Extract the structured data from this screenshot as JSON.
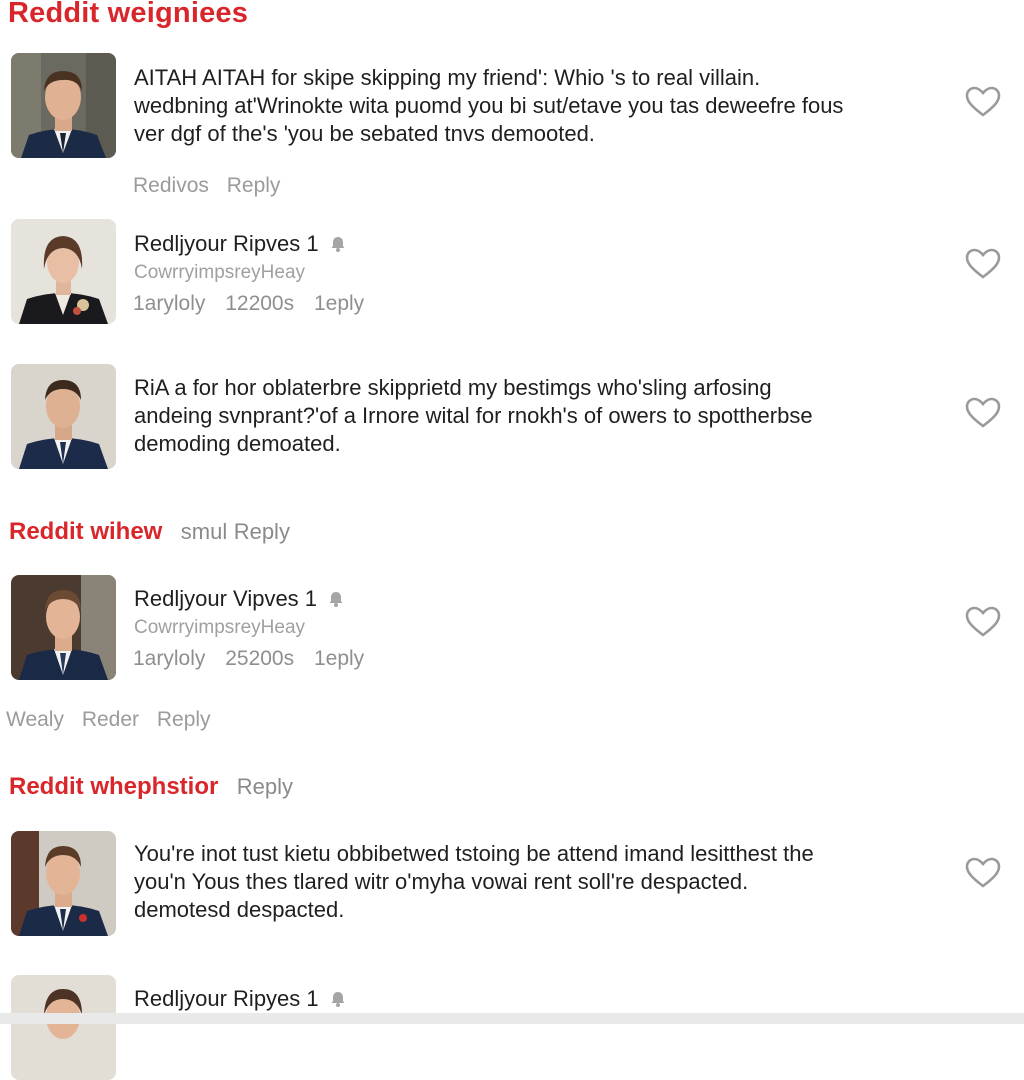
{
  "header": {
    "title": "Reddit weigniees"
  },
  "posts": [
    {
      "lines": [
        "AITAH AITAH for skipe skipping my friend': Whio 's to real villain.",
        "wedbning at'Wrinokte wita puomd you bi sut/etave you tas deweefre fous",
        "ver dgf of the's 'you be sebated tnvs demooted."
      ],
      "actions": [
        "Redivos",
        "Reply"
      ]
    },
    {
      "name": "Redljyour Ripves 1",
      "subtitle": "CowrryimpsreyHeay",
      "stats": [
        "1aryloly",
        "12200s",
        "1eply"
      ]
    },
    {
      "lines": [
        "RiA a for hor oblaterbre skipprietd my bestimgs who'sling arfosing",
        "andeing svnprant?'of a Irnore wital for rnokh's of owers to spottherbse",
        "demoding demoated."
      ]
    }
  ],
  "section1": {
    "title": "Reddit  wihew",
    "extra": "smul",
    "reply": "Reply"
  },
  "user2": {
    "name": "Redljyour Vipves 1",
    "subtitle": "CowrryimpsreyHeay",
    "stats": [
      "1aryloly",
      "25200s",
      "1eply"
    ],
    "actions": [
      "Wealy",
      "Reder",
      "Reply"
    ]
  },
  "section2": {
    "title": "Reddit  whephstior",
    "reply": "Reply"
  },
  "post4": {
    "lines": [
      "You're inot tust kietu obbibetwed tstoing be attend imand lesitthest the",
      "you'n Yous thes tlared witr o'myha vowai rent soll're despacted.",
      "demotesd despacted."
    ]
  },
  "user3": {
    "name": "Redljyour Ripyes 1"
  },
  "colors": {
    "accent": "#d8262b",
    "muted": "#9b9b9b",
    "text": "#1f1f1f"
  },
  "icons": {
    "like": "heart-outline-icon",
    "notify": "bell-icon"
  }
}
